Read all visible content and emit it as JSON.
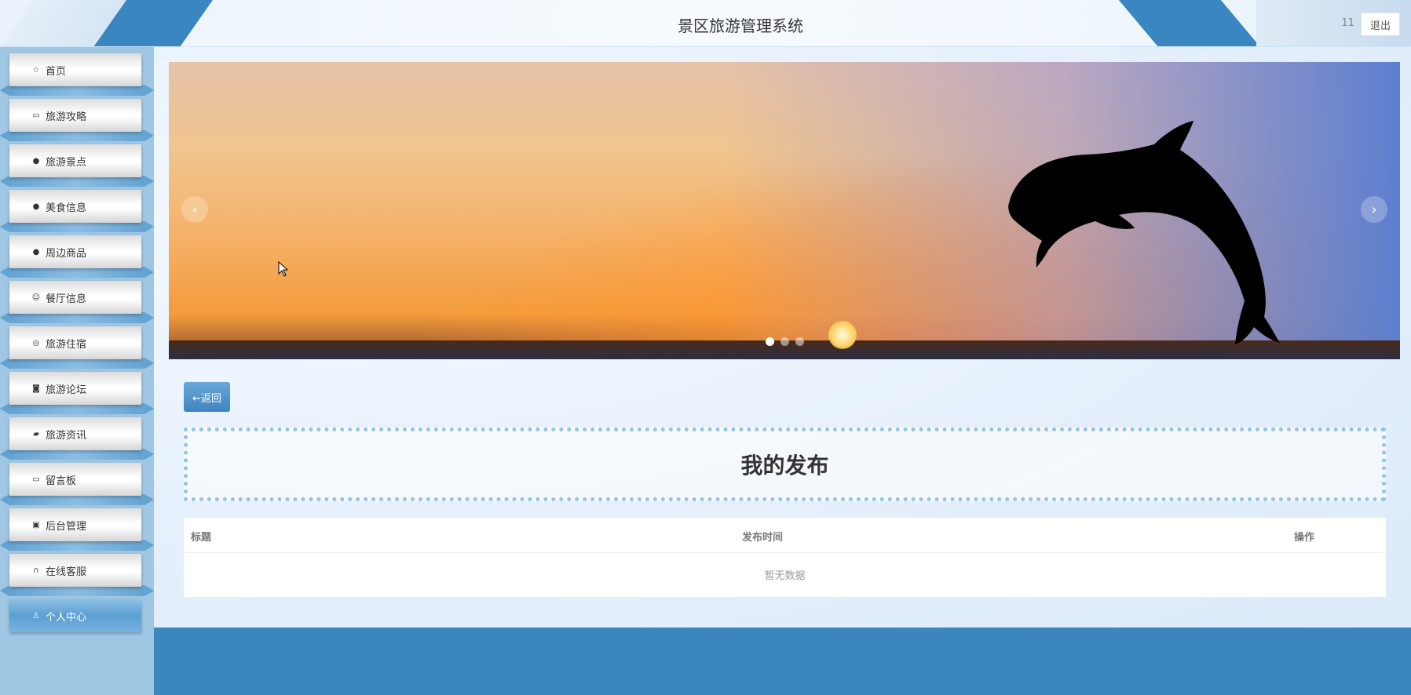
{
  "header": {
    "title": "景区旅游管理系统",
    "username": "11",
    "logout_label": "退出"
  },
  "sidebar": {
    "items": [
      {
        "label": "首页",
        "icon": "star-icon"
      },
      {
        "label": "旅游攻略",
        "icon": "bag-icon"
      },
      {
        "label": "旅游景点",
        "icon": "alert-circle-icon"
      },
      {
        "label": "美食信息",
        "icon": "question-circle-icon"
      },
      {
        "label": "周边商品",
        "icon": "info-circle-icon"
      },
      {
        "label": "餐厅信息",
        "icon": "smile-icon"
      },
      {
        "label": "旅游住宿",
        "icon": "check-circle-icon"
      },
      {
        "label": "旅游论坛",
        "icon": "camera-icon"
      },
      {
        "label": "旅游资讯",
        "icon": "car-icon"
      },
      {
        "label": "留言板",
        "icon": "video-icon"
      },
      {
        "label": "后台管理",
        "icon": "briefcase-icon"
      },
      {
        "label": "在线客服",
        "icon": "headset-icon"
      },
      {
        "label": "个人中心",
        "icon": "user-icon",
        "active": true
      }
    ]
  },
  "carousel": {
    "prev_glyph": "‹",
    "next_glyph": "›",
    "slide_count": 3,
    "active_index": 0
  },
  "back_label": "←返回",
  "page_title": "我的发布",
  "table": {
    "columns": [
      "标题",
      "发布时间",
      "操作"
    ],
    "empty_text": "暂无数据"
  },
  "colors": {
    "accent": "#3a86bd",
    "sidebar_bg": "#9fc6e3",
    "dotted_border": "#93c3e5"
  }
}
